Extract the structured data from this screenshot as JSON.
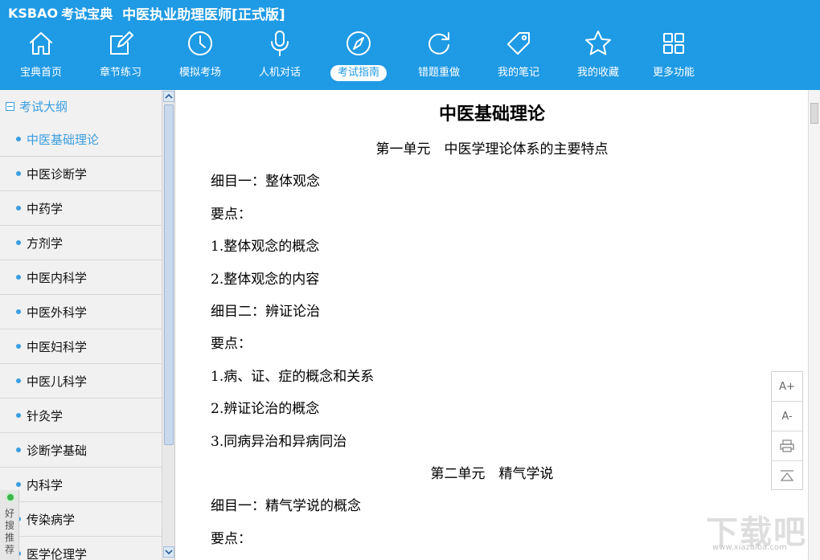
{
  "app": {
    "logo": "KSBAO",
    "logo_suffix": "考试宝典",
    "title": "中医执业助理医师[正式版]"
  },
  "nav": [
    {
      "label": "宝典首页",
      "icon": "home-icon"
    },
    {
      "label": "章节练习",
      "icon": "edit-icon"
    },
    {
      "label": "模拟考场",
      "icon": "clock-icon"
    },
    {
      "label": "人机对话",
      "icon": "microphone-icon"
    },
    {
      "label": "考试指南",
      "icon": "compass-icon",
      "active": true
    },
    {
      "label": "错题重做",
      "icon": "refresh-icon"
    },
    {
      "label": "我的笔记",
      "icon": "tag-icon"
    },
    {
      "label": "我的收藏",
      "icon": "star-icon"
    },
    {
      "label": "更多功能",
      "icon": "grid-icon"
    }
  ],
  "sidebar": {
    "header": "考试大纲",
    "items": [
      {
        "label": "中医基础理论",
        "active": true
      },
      {
        "label": "中医诊断学"
      },
      {
        "label": "中药学"
      },
      {
        "label": "方剂学"
      },
      {
        "label": "中医内科学"
      },
      {
        "label": "中医外科学"
      },
      {
        "label": "中医妇科学"
      },
      {
        "label": "中医儿科学"
      },
      {
        "label": "针灸学"
      },
      {
        "label": "诊断学基础"
      },
      {
        "label": "内科学"
      },
      {
        "label": "传染病学"
      },
      {
        "label": "医学伦理学"
      }
    ],
    "recommend": "好搜推荐"
  },
  "document": {
    "title": "中医基础理论",
    "lines": [
      {
        "text": "第一单元　中医学理论体系的主要特点",
        "align": "center"
      },
      {
        "text": "细目一：整体观念",
        "align": "left"
      },
      {
        "text": "要点：",
        "align": "left"
      },
      {
        "text": "1.整体观念的概念",
        "align": "left"
      },
      {
        "text": "2.整体观念的内容",
        "align": "left"
      },
      {
        "text": "细目二：辨证论治",
        "align": "left"
      },
      {
        "text": "要点：",
        "align": "left"
      },
      {
        "text": "1.病、证、症的概念和关系",
        "align": "left"
      },
      {
        "text": "2.辨证论治的概念",
        "align": "left"
      },
      {
        "text": "3.同病异治和异病同治",
        "align": "left"
      },
      {
        "text": "第二单元　精气学说",
        "align": "center"
      },
      {
        "text": "细目一：精气学说的概念",
        "align": "left"
      },
      {
        "text": "要点：",
        "align": "left"
      }
    ]
  },
  "tools": {
    "font_increase": "A+",
    "font_decrease": "A-"
  },
  "watermark": {
    "text": "下载吧",
    "url": "www.xiazaiba.com"
  },
  "colors": {
    "header": "#1f9ae4",
    "accent": "#3a9ee0"
  }
}
